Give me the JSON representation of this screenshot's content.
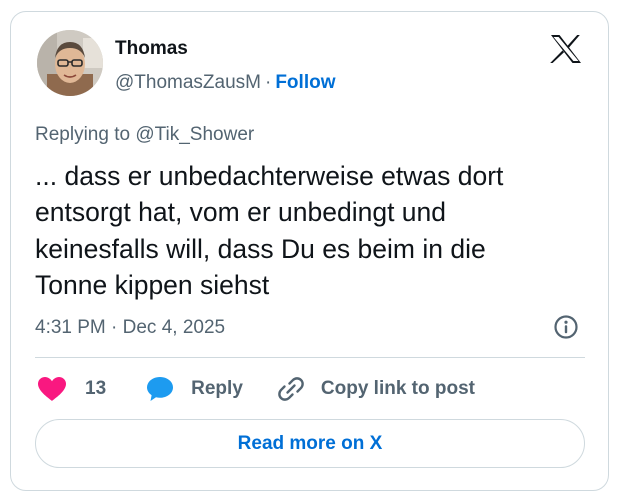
{
  "author": {
    "name": "Thomas",
    "handle": "@ThomasZausM",
    "separator": "·",
    "follow_label": "Follow"
  },
  "icons": {
    "brand": "x-logo-icon",
    "info": "info-icon",
    "like": "heart-icon",
    "reply": "speech-bubble-icon",
    "copy_link": "link-icon"
  },
  "reply_context": "Replying to @Tik_Shower",
  "tweet_lines": [
    "... dass er unbedachterweise etwas dort",
    "entsorgt hat, vom er unbedingt und",
    "keinesfalls will, dass Du es beim in die",
    "Tonne kippen siehst"
  ],
  "timestamp": "4:31 PM · Dec 4, 2025",
  "actions": {
    "like_count": "13",
    "reply_label": "Reply",
    "copy_link_label": "Copy link to post"
  },
  "read_more_label": "Read more on X",
  "colors": {
    "accent": "#006fd6",
    "like": "#f91880",
    "reply_icon": "#1d9bf0",
    "text": "#0f1419",
    "secondary": "#536471",
    "border": "#cfd9de"
  }
}
